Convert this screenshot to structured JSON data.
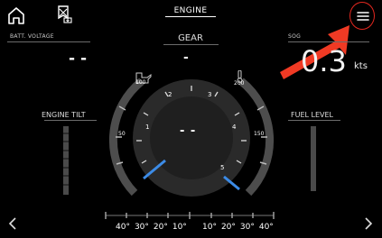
{
  "header": {
    "page_title": "ENGINE",
    "home_icon": "home-icon",
    "favorite_icon": "favorite-page-icon",
    "menu_icon": "hamburger-menu-icon"
  },
  "annotation": {
    "highlight_color": "#e2271f",
    "arrow_color": "#f03a24"
  },
  "battery": {
    "label": "BATT. VOLTAGE",
    "value": "- -"
  },
  "gear": {
    "label": "GEAR",
    "value": "-"
  },
  "speed": {
    "label": "SOG",
    "value": "0.3",
    "unit": "kts"
  },
  "engine_tilt": {
    "label": "ENGINE TILT"
  },
  "fuel": {
    "label": "FUEL LEVEL"
  },
  "tachometer": {
    "center_value": "- -",
    "rpm_labels": [
      "1",
      "2",
      "3",
      "4",
      "5"
    ],
    "oil_temp_labels": [
      "100",
      "50"
    ],
    "coolant_temp_labels": [
      "200",
      "150"
    ],
    "oil_icon": "oil-can-icon",
    "temp_icon": "thermometer-icon"
  },
  "trim_scale": {
    "left_labels": [
      "40°",
      "30°",
      "20°",
      "10°"
    ],
    "right_labels": [
      "10°",
      "20°",
      "30°",
      "40°"
    ]
  },
  "navigation": {
    "prev_icon": "chevron-left-icon",
    "next_icon": "chevron-right-icon"
  }
}
